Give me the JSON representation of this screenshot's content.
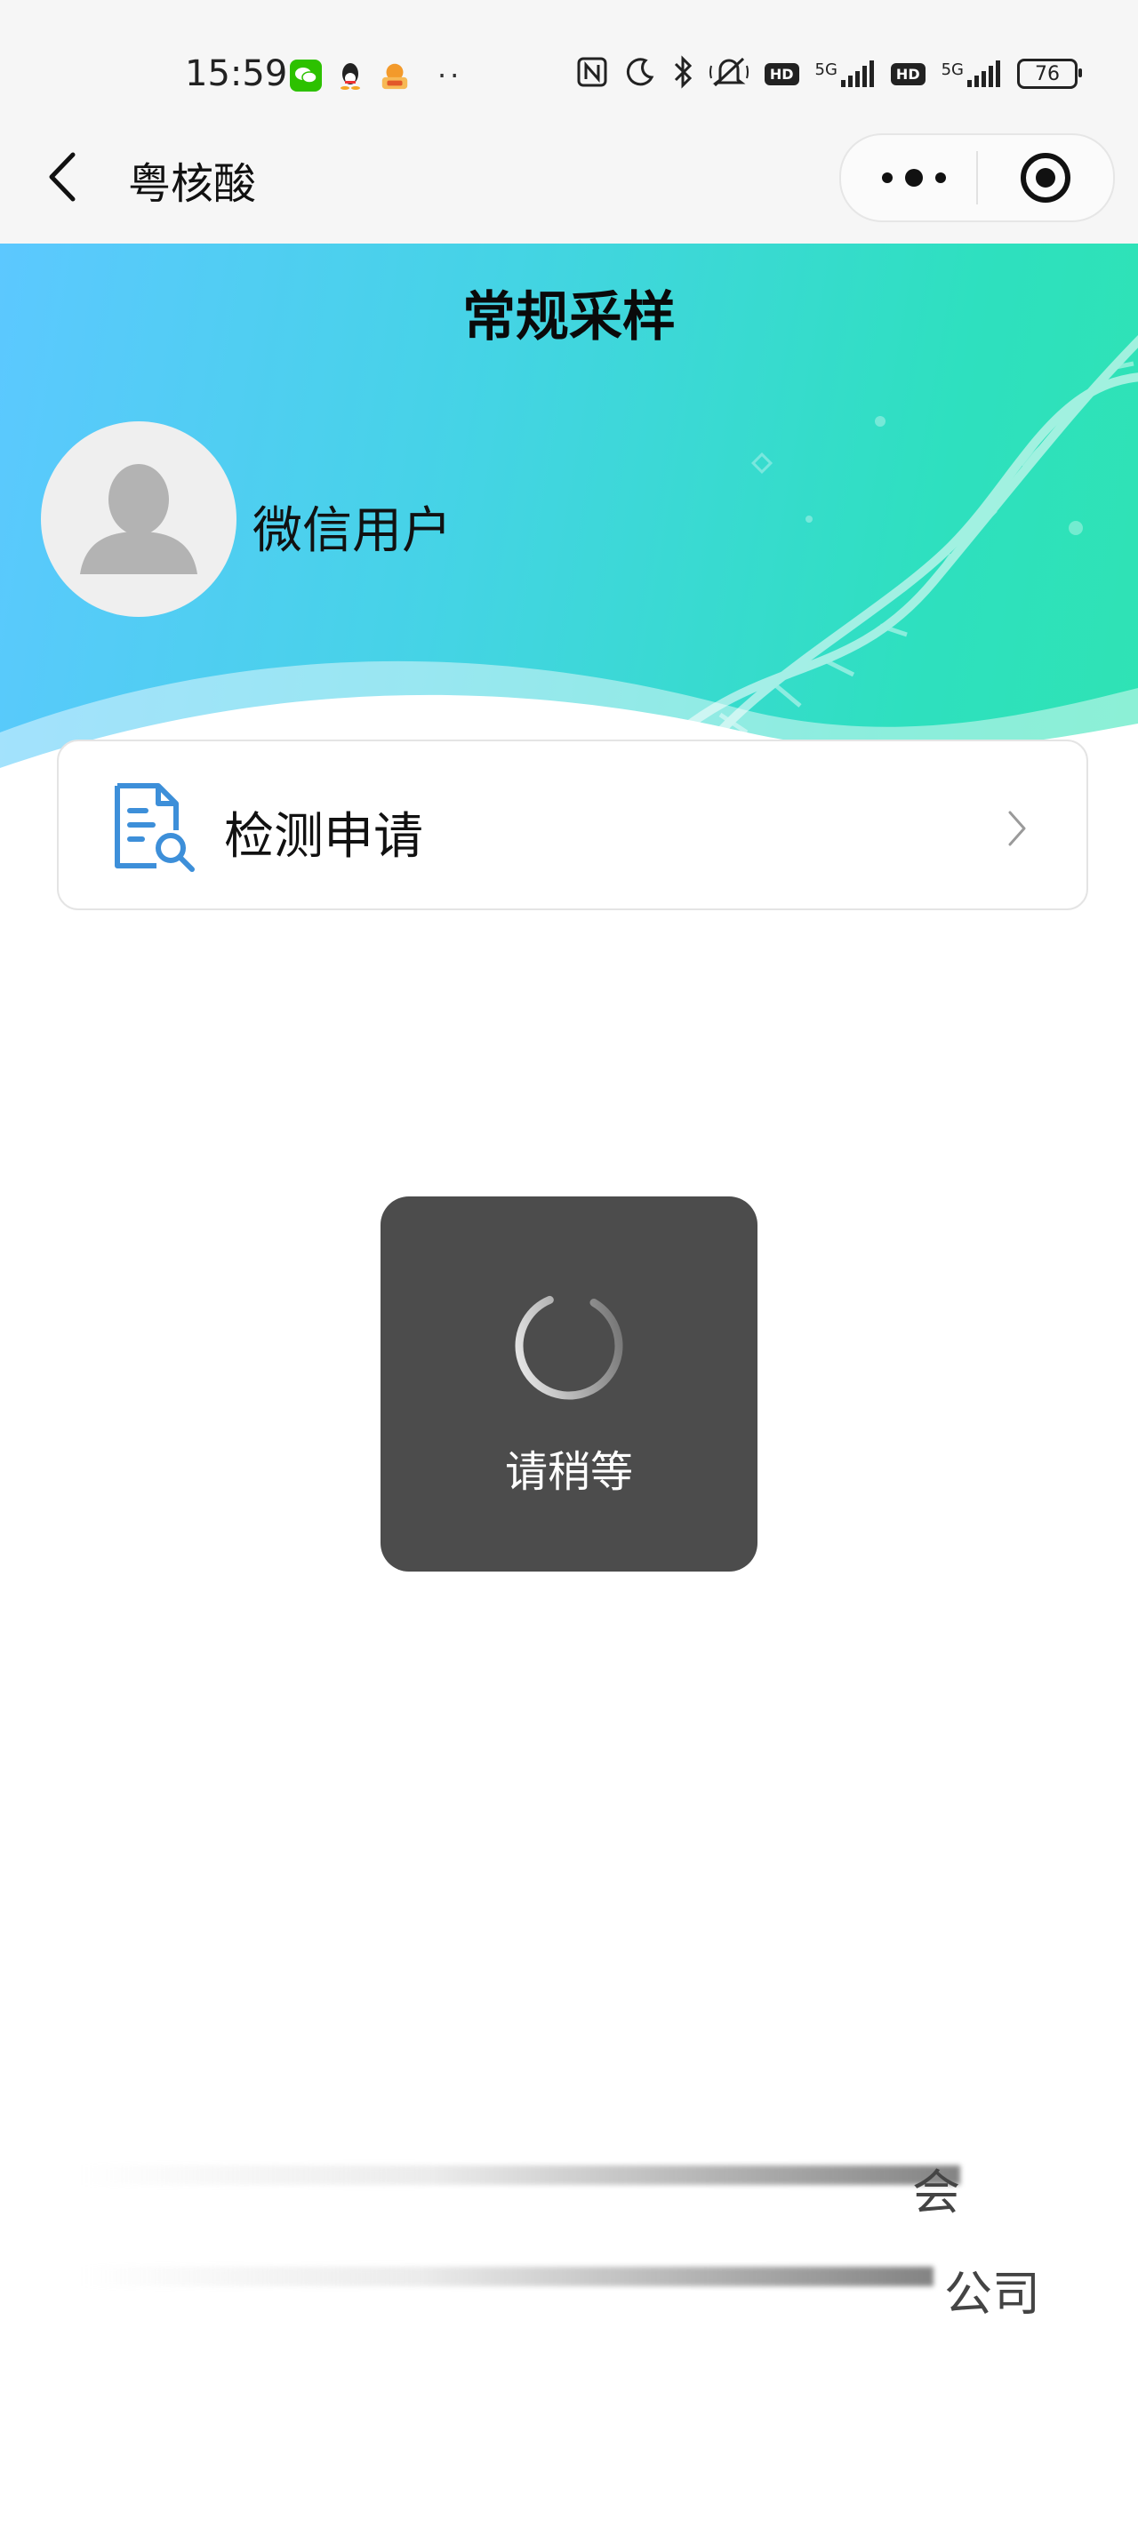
{
  "status_bar": {
    "time": "15:59",
    "app_icons": [
      "wechat-icon",
      "qq-icon",
      "app-badge-icon"
    ],
    "overflow": "··",
    "right_icons": [
      "nfc-icon",
      "moon-icon",
      "bluetooth-icon",
      "mute-icon"
    ],
    "hd1": "HD",
    "net1": "5G",
    "hd2": "HD",
    "net2": "5G",
    "battery": "76"
  },
  "nav": {
    "title": "粤核酸"
  },
  "hero": {
    "title": "常规采样",
    "user_name": "微信用户"
  },
  "apply_card": {
    "label": "检测申请"
  },
  "loading": {
    "text": "请稍等"
  },
  "footer": {
    "line1_tail": "会",
    "line2_tail": "公司"
  },
  "colors": {
    "hero_start": "#5cc8ff",
    "hero_end": "#2fe3b4",
    "toast_bg": "#4c4c4c",
    "accent_icon": "#3d8fd9"
  }
}
